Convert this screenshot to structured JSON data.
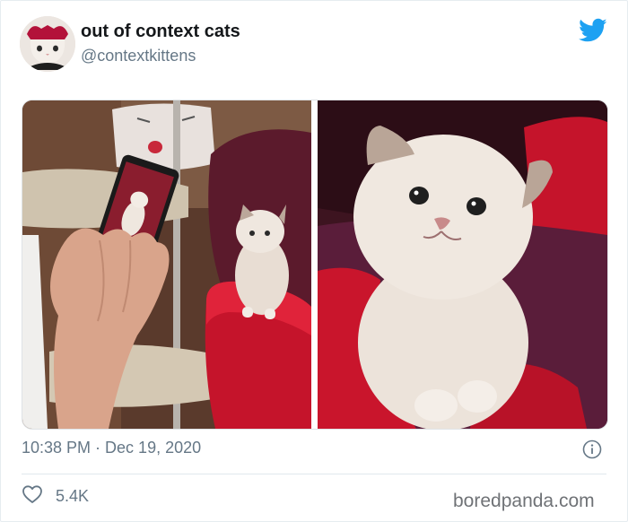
{
  "tweet": {
    "display_name": "out of context cats",
    "handle": "@contextkittens",
    "timestamp": "10:38 PM · Dec 19, 2020",
    "like_count": "5.4K",
    "brand_color": "#1da1f2"
  },
  "media": {
    "photos": [
      {
        "name": "kitten-watching-phone-photo"
      },
      {
        "name": "kitten-closeup-photo"
      }
    ]
  },
  "icons": {
    "platform": "twitter-bird-icon",
    "info": "info-icon",
    "like": "heart-icon"
  },
  "watermark": "boredpanda.com"
}
